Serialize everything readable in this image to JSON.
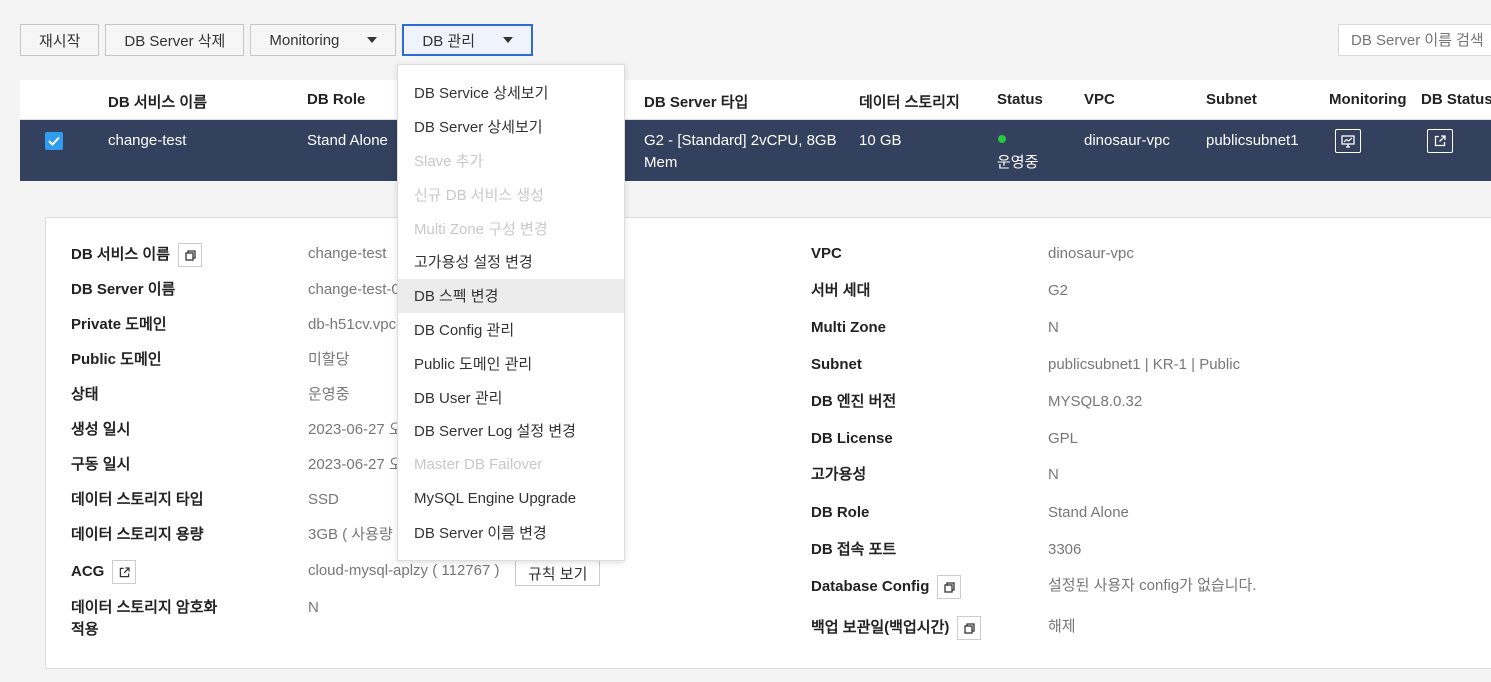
{
  "toolbar": {
    "restart": "재시작",
    "delete": "DB Server 삭제",
    "monitoring": "Monitoring",
    "db_manage": "DB 관리"
  },
  "search": {
    "placeholder": "DB Server 이름 검색"
  },
  "table": {
    "headers": [
      "DB 서비스 이름",
      "DB Role",
      "DB Server 타입",
      "데이터 스토리지",
      "Status",
      "VPC",
      "Subnet",
      "Monitoring",
      "DB Status"
    ],
    "row": {
      "checked": true,
      "service_name": "change-test",
      "role": "Stand Alone",
      "server_type_line1": "G2 - [Standard] 2vCPU, 8GB",
      "server_type_line2": "Mem",
      "storage": "10 GB",
      "status": "운영중",
      "vpc": "dinosaur-vpc",
      "subnet": "publicsubnet1"
    }
  },
  "menu": {
    "items": [
      {
        "label": "DB Service 상세보기",
        "disabled": false
      },
      {
        "label": "DB Server 상세보기",
        "disabled": false
      },
      {
        "label": "Slave 추가",
        "disabled": true
      },
      {
        "label": "신규 DB 서비스 생성",
        "disabled": true
      },
      {
        "label": "Multi Zone 구성 변경",
        "disabled": true
      },
      {
        "label": "고가용성 설정 변경",
        "disabled": false
      },
      {
        "label": "DB 스펙 변경",
        "disabled": false,
        "highlighted": true
      },
      {
        "label": "DB Config 관리",
        "disabled": false
      },
      {
        "label": "Public 도메인 관리",
        "disabled": false
      },
      {
        "label": "DB User 관리",
        "disabled": false
      },
      {
        "label": "DB Server Log 설정 변경",
        "disabled": false
      },
      {
        "label": "Master DB Failover",
        "disabled": true
      },
      {
        "label": "MySQL Engine Upgrade",
        "disabled": false
      },
      {
        "label": "DB Server 이름 변경",
        "disabled": false
      }
    ]
  },
  "detail": {
    "left": [
      {
        "label": "DB 서비스 이름",
        "value": "change-test"
      },
      {
        "label": "DB Server 이름",
        "value": "change-test-0"
      },
      {
        "label": "Private 도메인",
        "value": "db-h51cv.vpc-"
      },
      {
        "label": "Public 도메인",
        "value": "미할당"
      },
      {
        "label": "상태",
        "value": "운영중"
      },
      {
        "label": "생성 일시",
        "value": "2023-06-27 오"
      },
      {
        "label": "구동 일시",
        "value": "2023-06-27 오"
      },
      {
        "label": "데이터 스토리지 타입",
        "value": "SSD"
      },
      {
        "label": "데이터 스토리지 용량",
        "value": "3GB ( 사용량"
      },
      {
        "label": "ACG",
        "value": "cloud-mysql-aplzy ( 112767 )"
      },
      {
        "label_line1": "데이터 스토리지 암호화",
        "label_line2": "적용",
        "value": "N"
      }
    ],
    "acg_rule_button": "규칙 보기",
    "right": [
      {
        "label": "VPC",
        "value": "dinosaur-vpc"
      },
      {
        "label": "서버 세대",
        "value": "G2"
      },
      {
        "label": "Multi Zone",
        "value": "N"
      },
      {
        "label": "Subnet",
        "value": "publicsubnet1 | KR-1 | Public"
      },
      {
        "label": "DB 엔진 버전",
        "value": "MYSQL8.0.32"
      },
      {
        "label": "DB License",
        "value": "GPL"
      },
      {
        "label": "고가용성",
        "value": "N"
      },
      {
        "label": "DB Role",
        "value": "Stand Alone"
      },
      {
        "label": "DB 접속 포트",
        "value": "3306"
      },
      {
        "label": "Database Config",
        "value": "설정된 사용자 config가 없습니다."
      },
      {
        "label": "백업 보관일(백업시간)",
        "value": "해제"
      }
    ]
  },
  "colors": {
    "selected_row": "#33405e",
    "status_green": "#27c93f",
    "checkbox_blue": "#2f9cf0",
    "active_border": "#2f6bd7"
  }
}
